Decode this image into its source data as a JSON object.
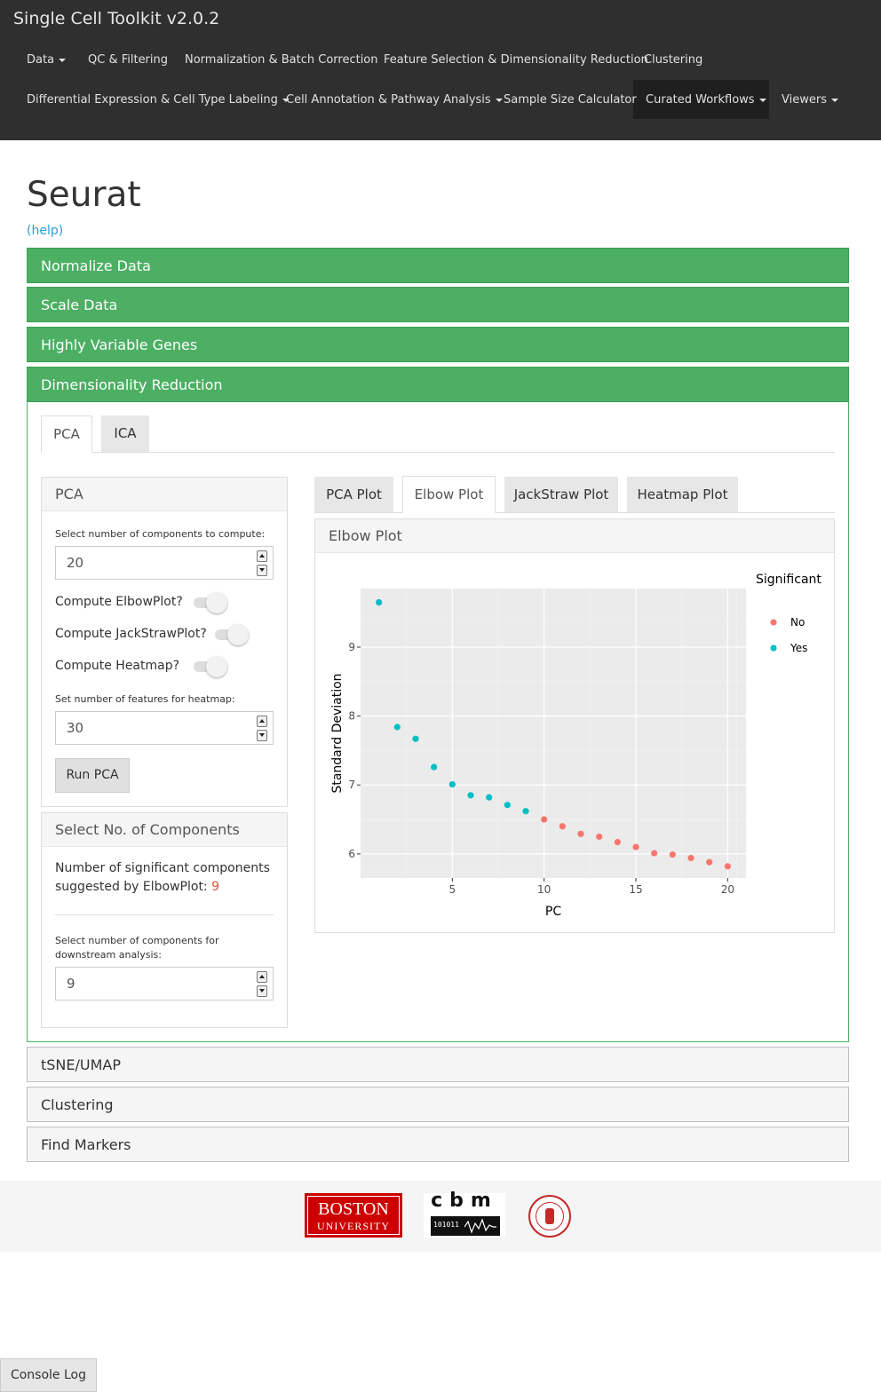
{
  "navbar": {
    "brand": "Single Cell Toolkit v2.0.2",
    "row1": [
      "Data",
      "QC & Filtering",
      "Normalization & Batch Correction",
      "Feature Selection & Dimensionality Reduction",
      "Clustering"
    ],
    "row2": [
      "Differential Expression & Cell Type Labeling",
      "Cell Annotation & Pathway Analysis",
      "Sample Size Calculator",
      "Curated Workflows",
      "Viewers"
    ],
    "active": "Curated Workflows"
  },
  "page": {
    "title": "Seurat",
    "help": "(help)"
  },
  "accordion": {
    "normalize": "Normalize Data",
    "scale": "Scale Data",
    "hvg": "Highly Variable Genes",
    "dimred": "Dimensionality Reduction",
    "tsne": "tSNE/UMAP",
    "clustering": "Clustering",
    "markers": "Find Markers"
  },
  "dimred_tabs": [
    "PCA",
    "ICA"
  ],
  "pca_panel": {
    "title": "PCA",
    "ncomp_label": "Select number of components to compute:",
    "ncomp_value": "20",
    "elbow_label": "Compute ElbowPlot?",
    "jackstraw_label": "Compute JackStrawPlot?",
    "heatmap_label": "Compute Heatmap?",
    "nfeat_label": "Set number of features for heatmap:",
    "nfeat_value": "30",
    "run_button": "Run PCA"
  },
  "select_panel": {
    "title": "Select No. of Components",
    "sig_text": "Number of significant components suggested by ElbowPlot:",
    "sig_value": "9",
    "down_label_1": "Select number of components for",
    "down_label_2": "downstream analysis:",
    "down_value": "9"
  },
  "plot_tabs": [
    "PCA Plot",
    "Elbow Plot",
    "JackStraw Plot",
    "Heatmap Plot"
  ],
  "plot_panel": {
    "title": "Elbow Plot"
  },
  "colors": {
    "no": "#f8766d",
    "yes": "#00bfc4",
    "green": "#4caf63",
    "link": "#2a9fd6",
    "sig_value": "#e74c3c"
  },
  "chart_data": {
    "type": "scatter",
    "xlabel": "PC",
    "ylabel": "Standard Deviation",
    "xlim": [
      0,
      21
    ],
    "ylim": [
      5.65,
      9.85
    ],
    "xticks": [
      5,
      10,
      15,
      20
    ],
    "yticks": [
      6,
      7,
      8,
      9
    ],
    "legend_title": "Significant",
    "legend_placement": "right",
    "series": [
      {
        "name": "No",
        "color": "#f8766d",
        "x": [
          10,
          11,
          12,
          13,
          14,
          15,
          16,
          17,
          18,
          19,
          20
        ],
        "y": [
          6.5,
          6.4,
          6.29,
          6.25,
          6.17,
          6.1,
          6.01,
          5.99,
          5.94,
          5.88,
          5.82
        ]
      },
      {
        "name": "Yes",
        "color": "#00bfc4",
        "x": [
          1,
          2,
          3,
          4,
          5,
          6,
          7,
          8,
          9
        ],
        "y": [
          9.65,
          7.84,
          7.67,
          7.26,
          7.01,
          6.85,
          6.82,
          6.71,
          6.62
        ]
      }
    ]
  },
  "footer": {
    "bu_line1": "BOSTON",
    "bu_line2": "UNIVERSITY",
    "cbm": "cbm",
    "cbm_bits": "101011"
  },
  "console": "Console Log"
}
